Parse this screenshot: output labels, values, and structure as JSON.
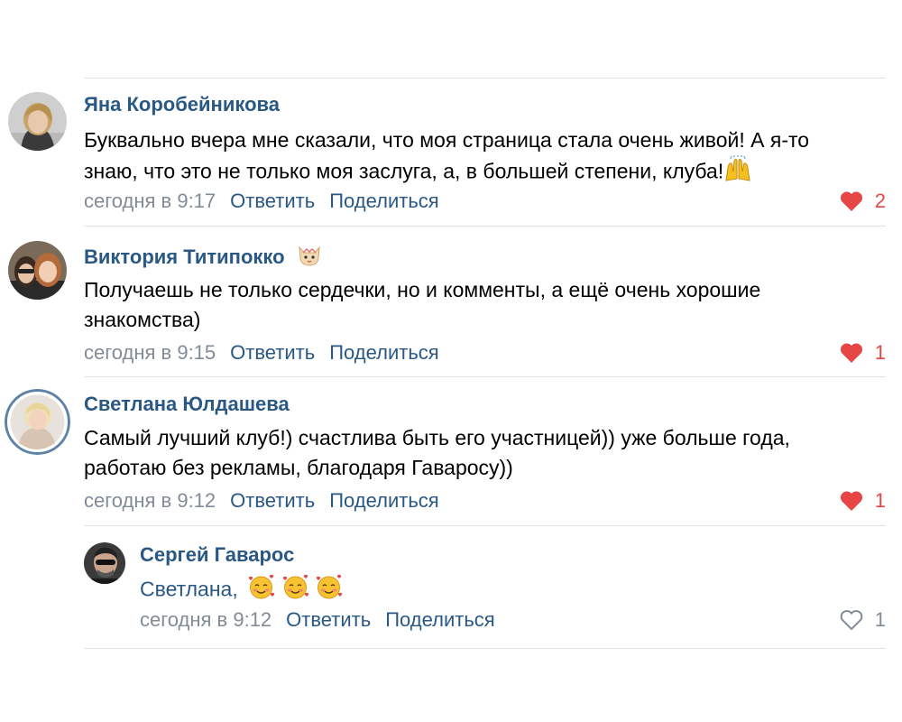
{
  "comments": [
    {
      "author": "Яна Коробейникова",
      "text_line1": "Буквально вчера мне сказали, что моя страница стала очень живой! А я-то",
      "text_line2": "знаю, что это не только моя заслуга, а, в большей степени, клуба!",
      "time": "сегодня в 9:17",
      "reply": "Ответить",
      "share": "Поделиться",
      "likes": "2"
    },
    {
      "author": "Виктория Титипокко",
      "text_line1": "Получаешь не только сердечки, но и комменты, а ещё очень хорошие",
      "text_line2": "знакомства)",
      "time": "сегодня в 9:15",
      "reply": "Ответить",
      "share": "Поделиться",
      "likes": "1"
    },
    {
      "author": "Светлана Юлдашева",
      "text_line1": "Самый лучший клуб!) счастлива быть его участницей)) уже больше года,",
      "text_line2": "работаю без рекламы, благодаря Гаваросу))",
      "time": "сегодня в 9:12",
      "reply": "Ответить",
      "share": "Поделиться",
      "likes": "1"
    },
    {
      "author": "Сергей Гаварос",
      "text_mention": "Светлана,",
      "time": "сегодня в 9:12",
      "reply": "Ответить",
      "share": "Поделиться",
      "likes": "1"
    }
  ],
  "colors": {
    "link": "#2a5885",
    "meta": "#818c99",
    "heart_active": "#e64646",
    "divider": "#e1e3e6"
  }
}
